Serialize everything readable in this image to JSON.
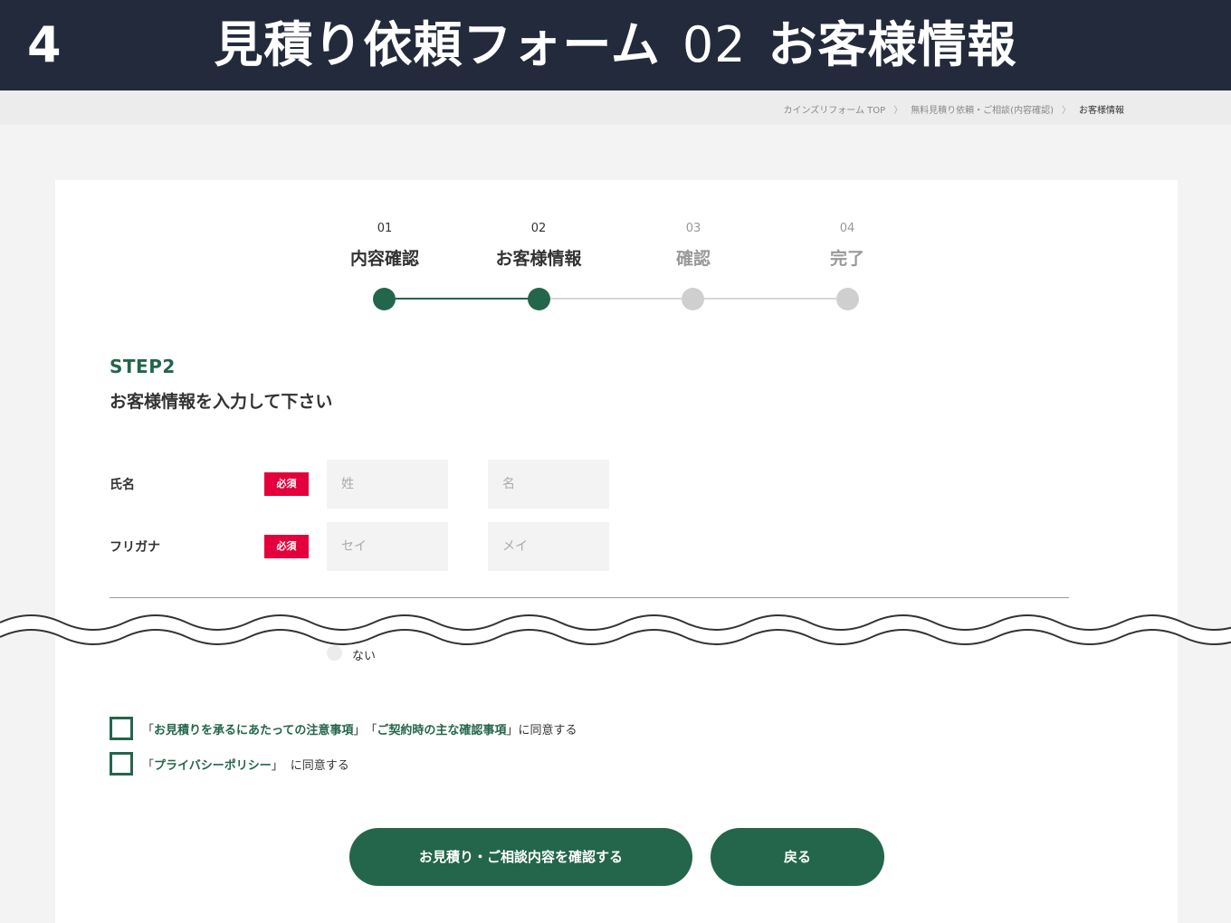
{
  "banner": {
    "number": "4",
    "title_main": "見積り依頼フォーム",
    "title_num": "02",
    "title_sub": "お客様情報"
  },
  "breadcrumb": {
    "items": [
      "カインズリフォーム TOP",
      "無料見積り依頼・ご相談(内容確認)",
      "お客様情報"
    ],
    "separator": "〉"
  },
  "steps": [
    {
      "number": "01",
      "label": "内容確認",
      "state": "done"
    },
    {
      "number": "02",
      "label": "お客様情報",
      "state": "current"
    },
    {
      "number": "03",
      "label": "確認",
      "state": "pending"
    },
    {
      "number": "04",
      "label": "完了",
      "state": "pending"
    }
  ],
  "form": {
    "step_title": "STEP2",
    "step_subtitle": "お客様情報を入力して下さい",
    "required_label": "必須",
    "name": {
      "label": "氏名",
      "last_placeholder": "姓",
      "first_placeholder": "名"
    },
    "kana": {
      "label": "フリガナ",
      "last_placeholder": "セイ",
      "first_placeholder": "メイ"
    },
    "radio_option": "ない"
  },
  "agreements": {
    "row1": {
      "open1": "「",
      "link1": "お見積りを承るにあたっての注意事項",
      "close1": "」",
      "open2": "「",
      "link2": "ご契約時の主な確認事項",
      "close2": "」",
      "suffix": "に同意する"
    },
    "row2": {
      "open": "「",
      "link": "プライバシーポリシー",
      "close": "」",
      "suffix": "に同意する"
    }
  },
  "buttons": {
    "confirm": "お見積り・ご相談内容を確認する",
    "back": "戻る"
  },
  "colors": {
    "brand": "#23664b",
    "required": "#e3003c",
    "banner": "#232a3b",
    "inactive_step": "#cfcfcf"
  }
}
